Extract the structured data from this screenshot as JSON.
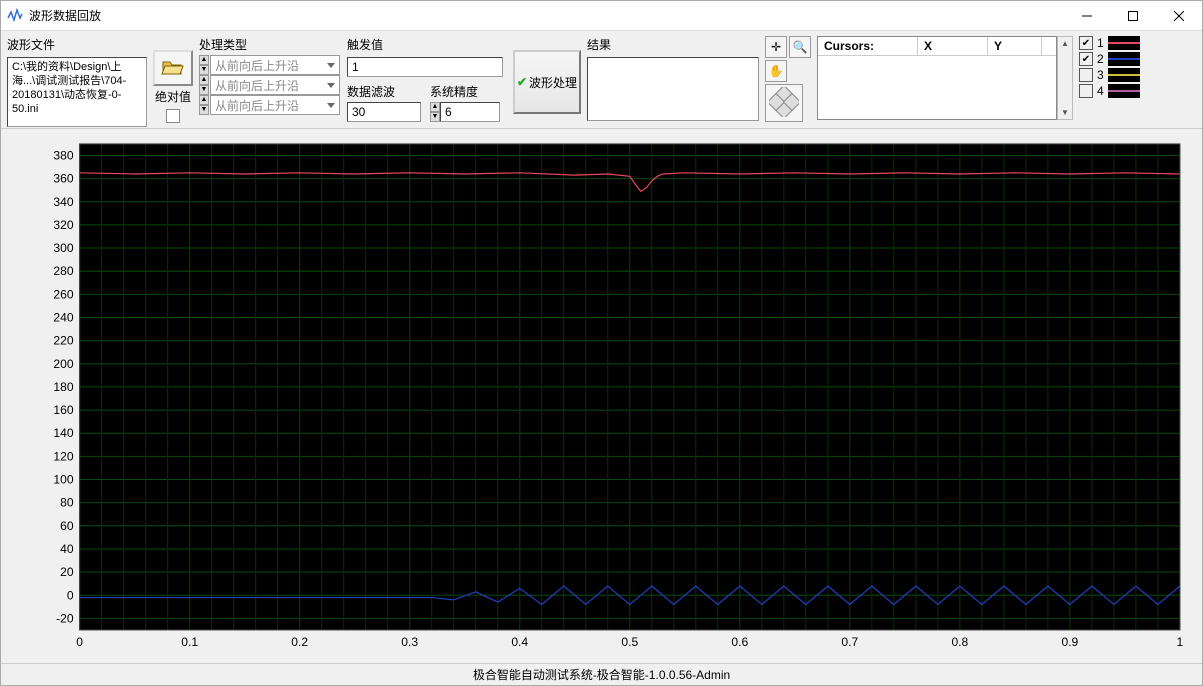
{
  "window": {
    "title": "波形数据回放"
  },
  "toolbar": {
    "file_label": "波形文件",
    "file_path": "C:\\我的资料\\Design\\上海...\\调试测试报告\\704-20180131\\动态恢复-0-50.ini",
    "abs_label": "绝对值",
    "abs_checked": false,
    "proc_type_label": "处理类型",
    "proc_type_options": [
      "从前向后上升沿",
      "从前向后上升沿",
      "从前向后上升沿"
    ],
    "trigger_label": "触发值",
    "trigger_value": "1",
    "filter_label": "数据滤波",
    "filter_value": "30",
    "precision_label": "系统精度",
    "precision_value": "6",
    "process_btn": "波形处理",
    "result_label": "结果"
  },
  "cursor_panel": {
    "header_cursors": "Cursors:",
    "header_x": "X",
    "header_y": "Y"
  },
  "legend": [
    {
      "id": 1,
      "checked": true,
      "color": "lg-c1"
    },
    {
      "id": 2,
      "checked": true,
      "color": "lg-c2"
    },
    {
      "id": 3,
      "checked": false,
      "color": "lg-c3"
    },
    {
      "id": 4,
      "checked": false,
      "color": "lg-c4"
    }
  ],
  "status_bar": "极合智能自动测试系统-极合智能-1.0.0.56-Admin",
  "chart_data": {
    "type": "line",
    "xlabel": "",
    "ylabel": "",
    "xlim": [
      0,
      1
    ],
    "ylim": [
      -30,
      390
    ],
    "x_ticks": [
      0,
      0.1,
      0.2,
      0.3,
      0.4,
      0.5,
      0.6,
      0.7,
      0.8,
      0.9,
      1
    ],
    "y_ticks": [
      -20,
      0,
      20,
      40,
      60,
      80,
      100,
      120,
      140,
      160,
      180,
      200,
      220,
      240,
      260,
      280,
      300,
      320,
      340,
      360,
      380
    ],
    "series": [
      {
        "name": "1",
        "color": "#e84860",
        "x": [
          0,
          0.05,
          0.1,
          0.15,
          0.2,
          0.25,
          0.3,
          0.35,
          0.4,
          0.45,
          0.48,
          0.5,
          0.505,
          0.51,
          0.515,
          0.52,
          0.525,
          0.53,
          0.55,
          0.6,
          0.65,
          0.7,
          0.75,
          0.8,
          0.85,
          0.9,
          0.95,
          1
        ],
        "values": [
          365,
          364,
          365,
          364,
          365,
          364,
          365,
          364,
          365,
          363,
          364,
          362,
          355,
          349,
          352,
          358,
          362,
          364,
          365,
          364,
          365,
          364,
          365,
          364,
          365,
          364,
          365,
          364
        ]
      },
      {
        "name": "2",
        "color": "#2040c0",
        "x": [
          0,
          0.05,
          0.1,
          0.15,
          0.2,
          0.25,
          0.3,
          0.32,
          0.34,
          0.36,
          0.38,
          0.4,
          0.42,
          0.44,
          0.46,
          0.48,
          0.5,
          0.52,
          0.54,
          0.56,
          0.58,
          0.6,
          0.62,
          0.64,
          0.66,
          0.68,
          0.7,
          0.72,
          0.74,
          0.76,
          0.78,
          0.8,
          0.82,
          0.84,
          0.86,
          0.88,
          0.9,
          0.92,
          0.94,
          0.96,
          0.98,
          1
        ],
        "values": [
          -2,
          -2,
          -2,
          -2,
          -2,
          -2,
          -2,
          -2,
          -4,
          3,
          -6,
          6,
          -8,
          8,
          -8,
          8,
          -8,
          8,
          -8,
          8,
          -8,
          8,
          -8,
          8,
          -8,
          8,
          -8,
          8,
          -8,
          8,
          -8,
          8,
          -8,
          8,
          -8,
          8,
          -8,
          8,
          -8,
          8,
          -8,
          8
        ]
      }
    ]
  }
}
